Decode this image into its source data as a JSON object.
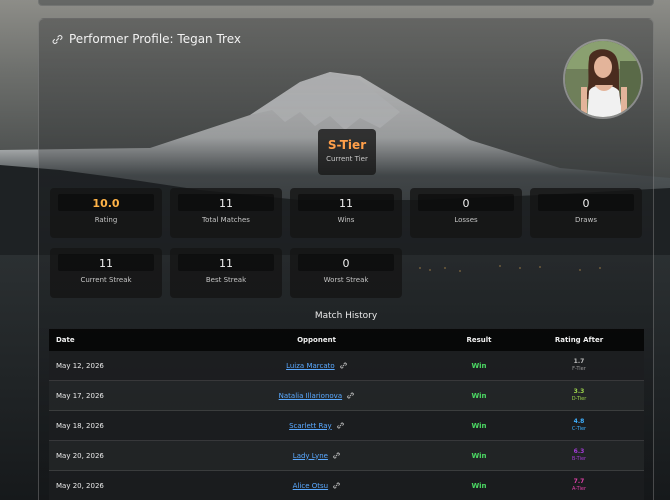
{
  "profile": {
    "title": "Performer Profile: Tegan Trex",
    "tier": "S-Tier",
    "tier_label": "Current Tier"
  },
  "stats": [
    {
      "value": "10.0",
      "label": "Rating"
    },
    {
      "value": "11",
      "label": "Total Matches"
    },
    {
      "value": "11",
      "label": "Wins"
    },
    {
      "value": "0",
      "label": "Losses"
    },
    {
      "value": "0",
      "label": "Draws"
    },
    {
      "value": "11",
      "label": "Current Streak"
    },
    {
      "value": "11",
      "label": "Best Streak"
    },
    {
      "value": "0",
      "label": "Worst Streak"
    }
  ],
  "match_history": {
    "title": "Match History",
    "headers": {
      "date": "Date",
      "opponent": "Opponent",
      "result": "Result",
      "rating": "Rating After"
    },
    "rows": [
      {
        "date": "May 12, 2026",
        "opponent": "Luiza Marcato",
        "result": "Win",
        "rating": "1.7",
        "tier": "F-Tier",
        "tier_color": "#9a9a9a"
      },
      {
        "date": "May 17, 2026",
        "opponent": "Natalia Illarionova",
        "result": "Win",
        "rating": "3.3",
        "tier": "D-Tier",
        "tier_color": "#9bd34a"
      },
      {
        "date": "May 18, 2026",
        "opponent": "Scarlett Ray",
        "result": "Win",
        "rating": "4.8",
        "tier": "C-Tier",
        "tier_color": "#3fb0ff"
      },
      {
        "date": "May 20, 2026",
        "opponent": "Lady Lyne",
        "result": "Win",
        "rating": "6.3",
        "tier": "B-Tier",
        "tier_color": "#a23ad6"
      },
      {
        "date": "May 20, 2026",
        "opponent": "Alice Otsu",
        "result": "Win",
        "rating": "7.7",
        "tier": "A-Tier",
        "tier_color": "#e040a8"
      }
    ]
  },
  "colors": {
    "tier_accent": "#ff9f4a",
    "rating_accent": "#ffb347",
    "win": "#4cd964",
    "link": "#5aa9ff"
  }
}
